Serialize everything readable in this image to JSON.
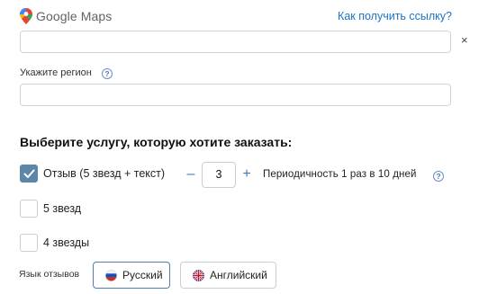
{
  "maps": {
    "brand": "Google Maps",
    "get_link": "Как получить ссылку?",
    "url_value": "",
    "close_symbol": "×"
  },
  "region": {
    "label": "Укажите регион",
    "help": "?",
    "value": ""
  },
  "services": {
    "title": "Выберите услугу, которую хотите заказать:",
    "items": [
      {
        "label": "Отзыв (5 звезд + текст)",
        "checked": true
      },
      {
        "label": "5 звезд",
        "checked": false
      },
      {
        "label": "4 звезды",
        "checked": false
      }
    ],
    "quantity": {
      "minus": "–",
      "value": "3",
      "plus": "+"
    },
    "period": "Периодичность 1 раз в 10 дней",
    "period_help": "?"
  },
  "language": {
    "label": "Язык отзывов",
    "options": [
      {
        "label": "Русский",
        "selected": true,
        "flag": "russia-flag"
      },
      {
        "label": "Английский",
        "selected": false,
        "flag": "uk-flag"
      }
    ]
  },
  "colors": {
    "accent": "#5d87a9",
    "link": "#1a73c8",
    "selected_border": "#4d80b3"
  }
}
